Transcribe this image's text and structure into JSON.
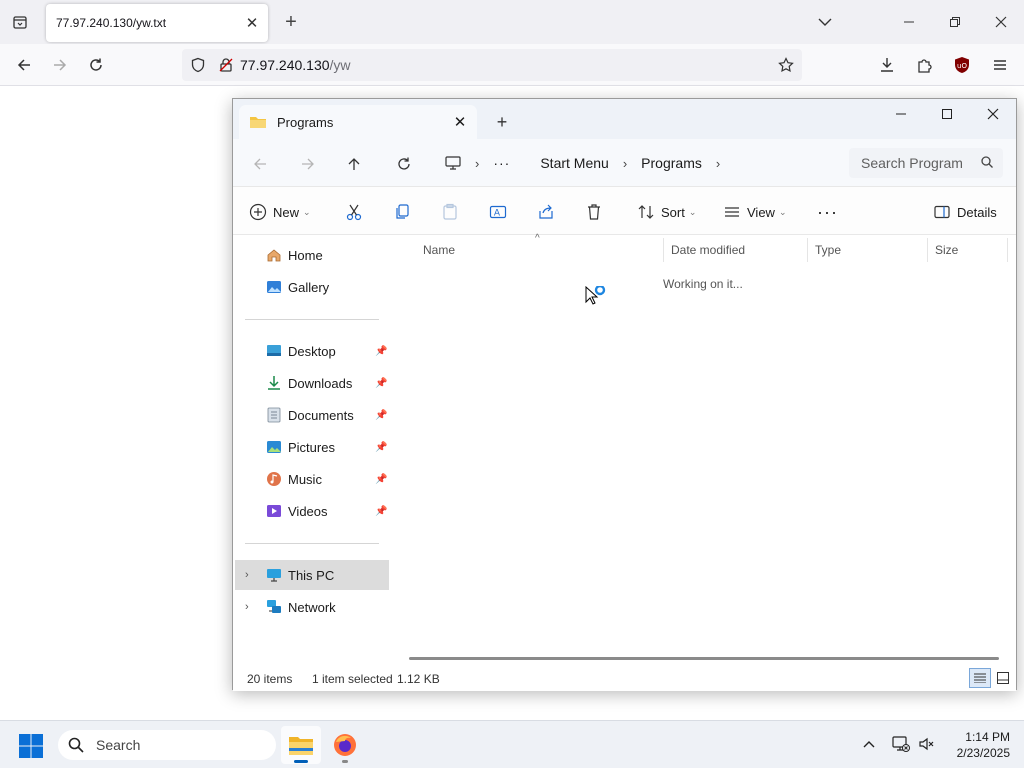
{
  "browser": {
    "tab_title": "77.97.240.130/yw.txt",
    "url_host": "77.97.240.130",
    "url_path": "/yw",
    "new_tab_label": "+"
  },
  "page": {
    "text": ""
  },
  "explorer": {
    "tab_title": "Programs",
    "breadcrumbs": [
      "Start Menu",
      "Programs"
    ],
    "search_placeholder": "Search Program",
    "commands": {
      "new": "New",
      "sort": "Sort",
      "view": "View",
      "details": "Details"
    },
    "nav_pane": {
      "home": "Home",
      "gallery": "Gallery",
      "pinned": [
        "Desktop",
        "Downloads",
        "Documents",
        "Pictures",
        "Music",
        "Videos"
      ],
      "this_pc": "This PC",
      "network": "Network"
    },
    "columns": {
      "name": "Name",
      "date": "Date modified",
      "type": "Type",
      "size": "Size"
    },
    "loading_text": "Working on it...",
    "status": {
      "count": "20 items",
      "selected": "1 item selected",
      "size": "1.12 KB"
    }
  },
  "taskbar": {
    "search_label": "Search",
    "time": "1:14 PM",
    "date": "2/23/2025"
  },
  "colors": {
    "accent": "#005fb8",
    "folder": "#f4c542",
    "ublock": "#800000"
  }
}
